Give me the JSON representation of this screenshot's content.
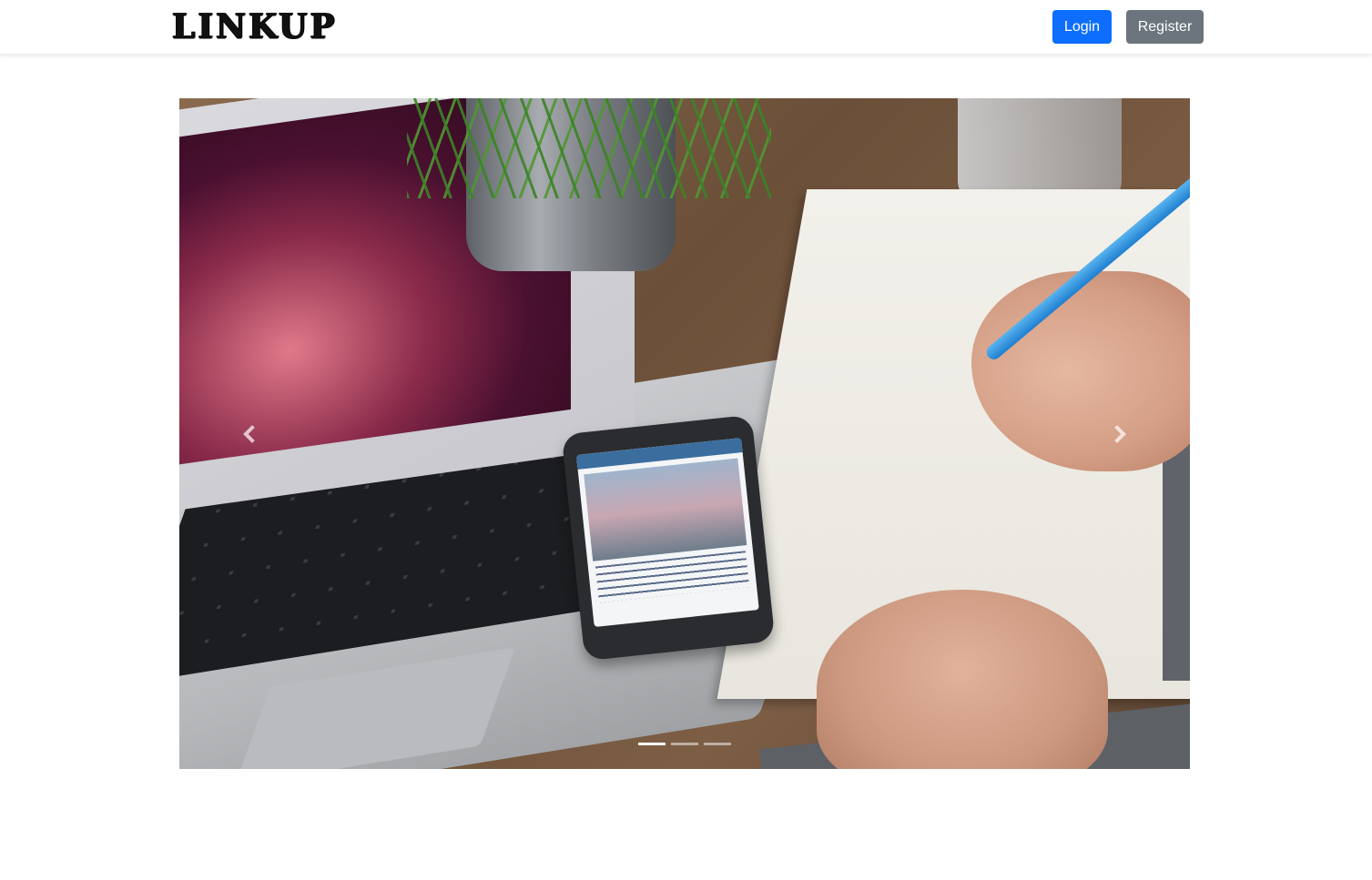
{
  "navbar": {
    "brand": "LINKUP",
    "login_label": "Login",
    "register_label": "Register"
  },
  "carousel": {
    "slide_count": 3,
    "active_index": 0,
    "image_description_icon": "carousel-photo",
    "prev_icon": "chevron-left-icon",
    "next_icon": "chevron-right-icon"
  },
  "colors": {
    "primary": "#0d6efd",
    "secondary": "#6c757d"
  }
}
